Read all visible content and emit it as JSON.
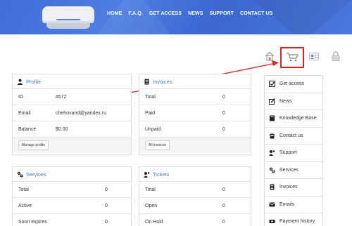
{
  "header": {
    "nav": [
      "HOME",
      "F.A.Q.",
      "GET ACCESS",
      "NEWS",
      "SUPPORT",
      "CONTACT US"
    ]
  },
  "annotation": {
    "highlight_color": "#e02020",
    "highlighted_icon": "cart-icon"
  },
  "profile": {
    "title": "Profile",
    "rows": [
      {
        "label": "ID",
        "value": "#672"
      },
      {
        "label": "Email",
        "value": "chehovand@yandex.ru"
      },
      {
        "label": "Balance",
        "value": "$0.00"
      }
    ],
    "button": "Manage profile"
  },
  "invoices": {
    "title": "Invoices",
    "rows": [
      {
        "label": "Total",
        "value": "0"
      },
      {
        "label": "Paid",
        "value": "0"
      },
      {
        "label": "Unpaid",
        "value": "0"
      }
    ],
    "button": "All invoices"
  },
  "services": {
    "title": "Services",
    "rows": [
      {
        "label": "Total",
        "value": "0"
      },
      {
        "label": "Active",
        "value": "0"
      },
      {
        "label": "Soon expires",
        "value": "0"
      }
    ]
  },
  "tickets": {
    "title": "Tickets",
    "rows": [
      {
        "label": "Total",
        "value": "0"
      },
      {
        "label": "Open",
        "value": "0"
      },
      {
        "label": "On Hold",
        "value": "0"
      }
    ]
  },
  "sidebar": {
    "items": [
      {
        "label": "Get access",
        "icon": "checkbox-icon"
      },
      {
        "label": "News",
        "icon": "edit-icon"
      },
      {
        "label": "Knowledge Base",
        "icon": "book-icon"
      },
      {
        "label": "Contact us",
        "icon": "phone-icon"
      },
      {
        "label": "Support",
        "icon": "support-icon"
      },
      {
        "label": "Services",
        "icon": "gears-icon"
      },
      {
        "label": "Invoices",
        "icon": "invoice-icon"
      },
      {
        "label": "Emails",
        "icon": "email-icon"
      },
      {
        "label": "Payment history",
        "icon": "payment-icon"
      }
    ]
  }
}
